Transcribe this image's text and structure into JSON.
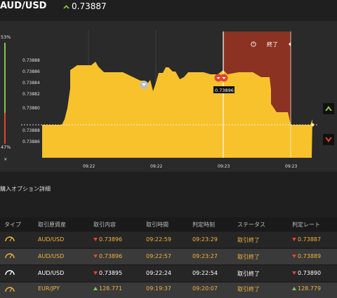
{
  "header": {
    "pair": "AUD/USD",
    "rate": "0.73887",
    "direction_icon": "up-arrow-icon",
    "rate_color": "#8bc34a"
  },
  "chart": {
    "y_ticks": [
      "0.73888",
      "0.73886",
      "0.73884",
      "0.73882",
      "0.73880",
      "0.73888",
      "0.73886",
      "0.73884"
    ],
    "x_ticks": [
      "09:22",
      "09:22",
      "09:23",
      "09:23"
    ],
    "pct_top": "53%",
    "pct_bottom": "47%",
    "close_label": "終了",
    "marker_label": "0.73896",
    "fill_color": "#f8c22d",
    "closed_zone_color": "#8b3222",
    "buttons": {
      "up": "up-chevron-icon",
      "down": "down-chevron-icon",
      "close": "×"
    }
  },
  "section_title": "購入オプション詳細",
  "table": {
    "headers": [
      "タイプ",
      "取引原資産",
      "取引内容",
      "取引時間",
      "判定時刻",
      "ステータス",
      "判定レート"
    ],
    "rows": [
      {
        "asset": "AUD/USD",
        "dir": "down",
        "value": "0.73896",
        "time": "09:22:59",
        "judge": "09:23:29",
        "status": "取引終了",
        "rate": "0.73887",
        "rate_dir": "down"
      },
      {
        "asset": "AUD/USD",
        "dir": "down",
        "value": "0.73896",
        "time": "09:22:57",
        "judge": "09:23:27",
        "status": "取引終了",
        "rate": "0.73889",
        "rate_dir": "down"
      },
      {
        "asset": "AUD/USD",
        "dir": "down",
        "value": "0.73895",
        "time": "09:22:24",
        "judge": "09:22:54",
        "status": "取引終了",
        "rate": "0.73890",
        "rate_dir": "down"
      },
      {
        "asset": "EUR/JPY",
        "dir": "up",
        "value": "128.771",
        "time": "09:19:37",
        "judge": "09:20:07",
        "status": "取引終了",
        "rate": "128.779",
        "rate_dir": "up"
      }
    ]
  }
}
